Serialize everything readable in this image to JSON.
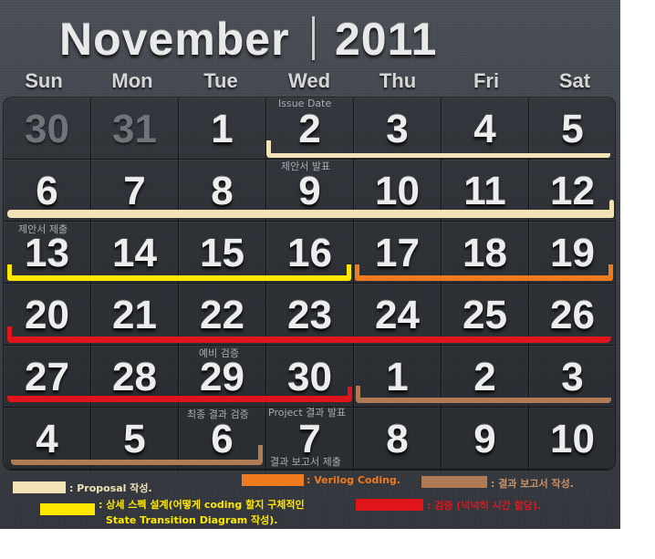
{
  "header": {
    "month": "November",
    "year": "2011"
  },
  "weekdays": [
    "Sun",
    "Mon",
    "Tue",
    "Wed",
    "Thu",
    "Fri",
    "Sat"
  ],
  "weeks": [
    [
      "30",
      "31",
      "1",
      "2",
      "3",
      "4",
      "5"
    ],
    [
      "6",
      "7",
      "8",
      "9",
      "10",
      "11",
      "12"
    ],
    [
      "13",
      "14",
      "15",
      "16",
      "17",
      "18",
      "19"
    ],
    [
      "20",
      "21",
      "22",
      "23",
      "24",
      "25",
      "26"
    ],
    [
      "27",
      "28",
      "29",
      "30",
      "1",
      "2",
      "3"
    ],
    [
      "4",
      "5",
      "6",
      "7",
      "8",
      "9",
      "10"
    ]
  ],
  "notes": {
    "issue_date": "Issue Date",
    "proposal_presentation": "제안서 발표",
    "proposal_submit": "제안서 제출",
    "preliminary_check": "예비 검증",
    "final_result_check": "최종 결과 검증",
    "project_result_presentation": "Project 결과 발표",
    "result_report_submit": "결과 보고서 제출"
  },
  "legend": {
    "proposal": ": Proposal 작성.",
    "spec_line1": ": 상세 스펙 설계(어떻게 coding 할지 구체적인",
    "spec_line2": "State Transition Diagram 작성).",
    "verilog": ": Verilog Coding.",
    "report": ": 결과 보고서 작성.",
    "verify": ": 검증 (넉넉히 시간 할당)."
  },
  "colors": {
    "proposal": "#f2e2b8",
    "spec": "#ffe800",
    "verilog": "#f07a1e",
    "report": "#b07a55",
    "verify": "#e0151b"
  }
}
